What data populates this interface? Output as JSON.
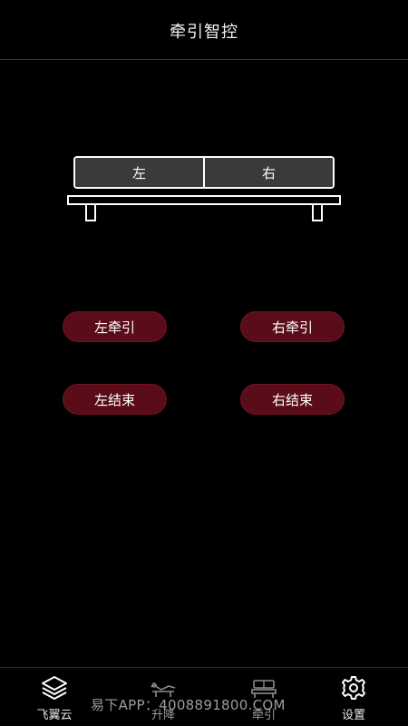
{
  "header": {
    "title": "牵引智控"
  },
  "bed": {
    "left_label": "左",
    "right_label": "右"
  },
  "controls": {
    "left_traction": "左牵引",
    "right_traction": "右牵引",
    "left_end": "左结束",
    "right_end": "右结束"
  },
  "tabs": [
    {
      "label": "飞翼云",
      "icon": "layers-icon"
    },
    {
      "label": "升降",
      "icon": "recliner-icon"
    },
    {
      "label": "牵引",
      "icon": "bed-icon"
    },
    {
      "label": "设置",
      "icon": "gear-icon"
    }
  ],
  "watermark": "易下APP：4008891800.COM",
  "colors": {
    "background": "#000000",
    "accent": "#5a0d19",
    "divider": "#7a1a26",
    "text": "#ffffff"
  }
}
